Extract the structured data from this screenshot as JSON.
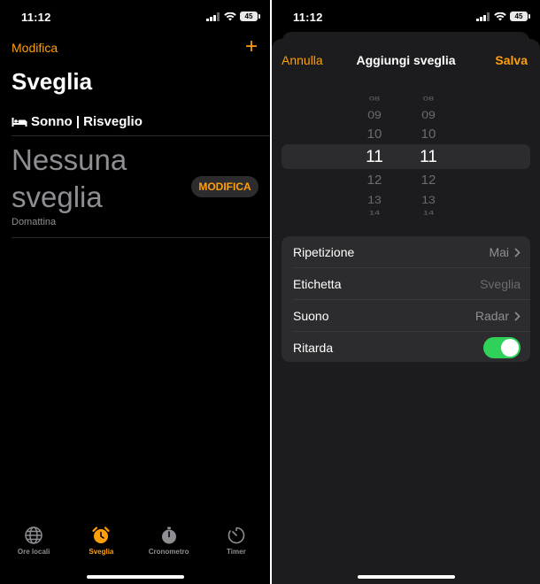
{
  "left": {
    "status": {
      "time": "11:12",
      "battery": "45"
    },
    "header": {
      "edit": "Modifica",
      "add": "+",
      "title": "Sveglia"
    },
    "sleep": {
      "icon": "bed-icon",
      "label": "Sonno | Risveglio"
    },
    "empty": {
      "title": "Nessuna sveglia",
      "subtitle": "Domattina",
      "button": "MODIFICA"
    },
    "tabs": [
      {
        "icon": "globe-icon",
        "label": "Ore locali",
        "active": false
      },
      {
        "icon": "alarm-icon",
        "label": "Sveglia",
        "active": true
      },
      {
        "icon": "stopwatch-icon",
        "label": "Cronometro",
        "active": false
      },
      {
        "icon": "timer-icon",
        "label": "Timer",
        "active": false
      }
    ]
  },
  "right": {
    "status": {
      "time": "11:12",
      "battery": "45"
    },
    "nav": {
      "cancel": "Annulla",
      "title": "Aggiungi sveglia",
      "save": "Salva"
    },
    "picker": {
      "hours": [
        "08",
        "09",
        "10",
        "11",
        "12",
        "13",
        "14"
      ],
      "minutes": [
        "08",
        "09",
        "10",
        "11",
        "12",
        "13",
        "14"
      ],
      "selected_hour": "11",
      "selected_minute": "11"
    },
    "settings": {
      "repeat": {
        "label": "Ripetizione",
        "value": "Mai"
      },
      "label_row": {
        "label": "Etichetta",
        "placeholder": "Sveglia"
      },
      "sound": {
        "label": "Suono",
        "value": "Radar"
      },
      "snooze": {
        "label": "Ritarda",
        "on": true
      }
    }
  },
  "colors": {
    "accent": "#ff9f0a",
    "toggle_on": "#30d158",
    "background": "#000000",
    "sheet": "#1c1c1e"
  }
}
